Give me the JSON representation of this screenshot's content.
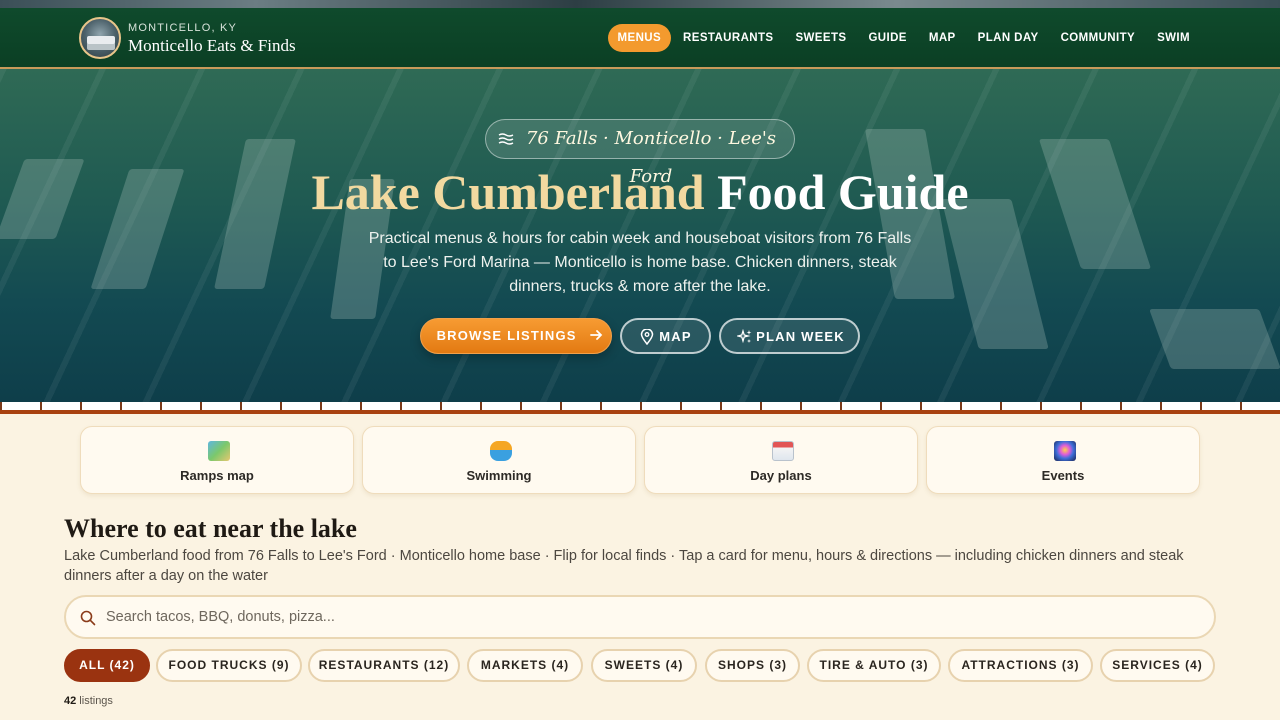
{
  "header": {
    "kicker": "MONTICELLO, KY",
    "brand": "Monticello Eats & Finds",
    "nav": [
      {
        "label": "MENUS",
        "active": true
      },
      {
        "label": "RESTAURANTS"
      },
      {
        "label": "SWEETS"
      },
      {
        "label": "GUIDE"
      },
      {
        "label": "MAP"
      },
      {
        "label": "PLAN DAY"
      },
      {
        "label": "COMMUNITY"
      },
      {
        "label": "SWIM"
      }
    ]
  },
  "hero": {
    "tagline": "76 Falls · Monticello · Lee's Ford",
    "title_accent": "Lake Cumberland",
    "title_rest": " Food Guide",
    "subtitle": "Practical menus & hours for cabin week and houseboat visitors from 76 Falls to Lee's Ford Marina — Monticello is home base. Chicken dinners, steak dinners, trucks & more after the lake.",
    "btn_browse": "BROWSE LISTINGS",
    "btn_map": "MAP",
    "btn_week": "PLAN WEEK"
  },
  "quick_cards": [
    {
      "label": "Ramps map",
      "icon": "map-icon"
    },
    {
      "label": "Swimming",
      "icon": "swimmer-icon"
    },
    {
      "label": "Day plans",
      "icon": "calendar-icon"
    },
    {
      "label": "Events",
      "icon": "fireworks-icon"
    }
  ],
  "section": {
    "title": "Where to eat near the lake",
    "description": "Lake Cumberland food from 76 Falls to Lee's Ford · Monticello home base · Flip for local finds · Tap a card for menu, hours & directions — including chicken dinners and steak dinners after a day on the water"
  },
  "search": {
    "placeholder": "Search tacos, BBQ, donuts, pizza...",
    "value": ""
  },
  "filters": [
    {
      "label": "ALL (42)",
      "active": true
    },
    {
      "label": "FOOD TRUCKS (9)"
    },
    {
      "label": "RESTAURANTS (12)"
    },
    {
      "label": "MARKETS (4)"
    },
    {
      "label": "SWEETS (4)"
    },
    {
      "label": "SHOPS (3)"
    },
    {
      "label": "TIRE & AUTO (3)"
    },
    {
      "label": "ATTRACTIONS (3)"
    },
    {
      "label": "SERVICES (4)"
    }
  ],
  "listing_count": "42",
  "listing_suffix": " listings",
  "colors": {
    "header_green": "#0f4a2c",
    "accent_orange": "#f39a2e",
    "chip_active": "#9a3310",
    "background": "#fbf3e2"
  }
}
